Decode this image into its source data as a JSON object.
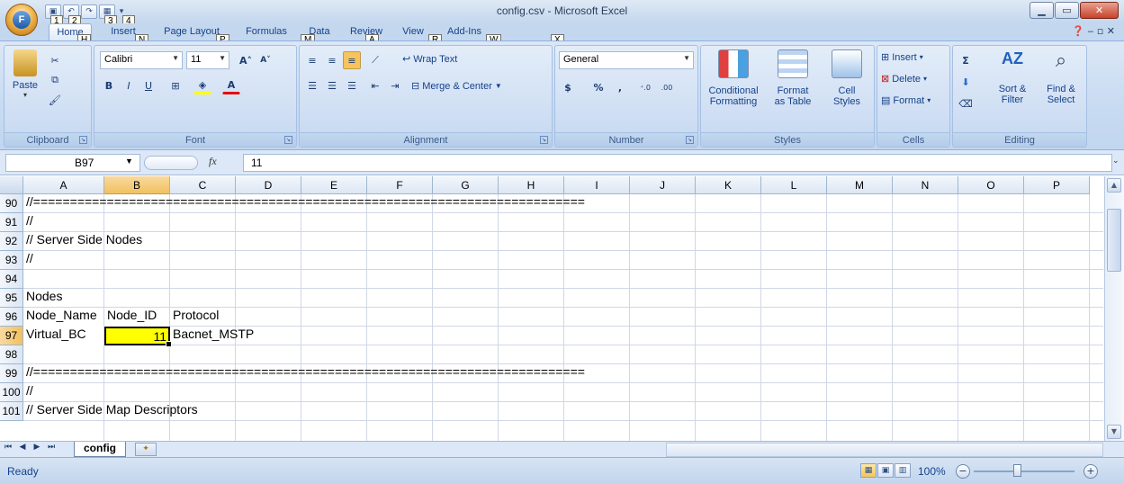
{
  "window": {
    "title": "config.csv - Microsoft Excel",
    "office_button_letter": "F"
  },
  "qat_keytips": [
    "1",
    "2",
    "3",
    "4"
  ],
  "ribbon_tabs": [
    {
      "label": "Home",
      "keytip": "H",
      "active": true
    },
    {
      "label": "Insert",
      "keytip": "N"
    },
    {
      "label": "Page Layout",
      "keytip": "P"
    },
    {
      "label": "Formulas",
      "keytip": "M"
    },
    {
      "label": "Data",
      "keytip": "A"
    },
    {
      "label": "Review",
      "keytip": "R"
    },
    {
      "label": "View",
      "keytip": "W"
    },
    {
      "label": "Add-Ins",
      "keytip": "X"
    }
  ],
  "clipboard": {
    "label": "Clipboard",
    "paste": "Paste"
  },
  "font": {
    "label": "Font",
    "name": "Calibri",
    "size": "11"
  },
  "alignment": {
    "label": "Alignment",
    "wrap": "Wrap Text",
    "merge": "Merge & Center"
  },
  "number": {
    "label": "Number",
    "format": "General",
    "currency": "$",
    "percent": "%",
    "comma": ","
  },
  "styles": {
    "label": "Styles",
    "conditional": "Conditional",
    "conditional2": "Formatting",
    "format_table": "Format",
    "format_table2": "as Table",
    "cell_styles": "Cell",
    "cell_styles2": "Styles"
  },
  "cells": {
    "label": "Cells",
    "insert": "Insert",
    "delete": "Delete",
    "format": "Format"
  },
  "editing": {
    "label": "Editing",
    "sort": "Sort &",
    "sort2": "Filter",
    "find": "Find &",
    "find2": "Select"
  },
  "formula_bar": {
    "name_box": "B97",
    "fx": "fx",
    "value": "11"
  },
  "columns": [
    "A",
    "B",
    "C",
    "D",
    "E",
    "F",
    "G",
    "H",
    "I",
    "J",
    "K",
    "L",
    "M",
    "N",
    "O",
    "P"
  ],
  "selected_column": "B",
  "rows": [
    {
      "num": "90",
      "a": "//==========================================================================="
    },
    {
      "num": "91",
      "a": "//"
    },
    {
      "num": "92",
      "a": "//   Server Side Nodes"
    },
    {
      "num": "93",
      "a": "//"
    },
    {
      "num": "94",
      "a": ""
    },
    {
      "num": "95",
      "a": "Nodes"
    },
    {
      "num": "96",
      "a": "Node_Name",
      "b": "Node_ID",
      "c": "Protocol"
    },
    {
      "num": "97",
      "a": "Virtual_BC",
      "b": "11",
      "c": "Bacnet_MSTP",
      "selected": true
    },
    {
      "num": "98",
      "a": ""
    },
    {
      "num": "99",
      "a": "//==========================================================================="
    },
    {
      "num": "100",
      "a": "//"
    },
    {
      "num": "101",
      "a": "//   Server Side Map Descriptors"
    }
  ],
  "sheet_tab": "config",
  "status": {
    "text": "Ready",
    "zoom": "100%"
  },
  "colors": {
    "active_cell_fill": "#ffff00",
    "selected_header": "#f6c45b"
  }
}
